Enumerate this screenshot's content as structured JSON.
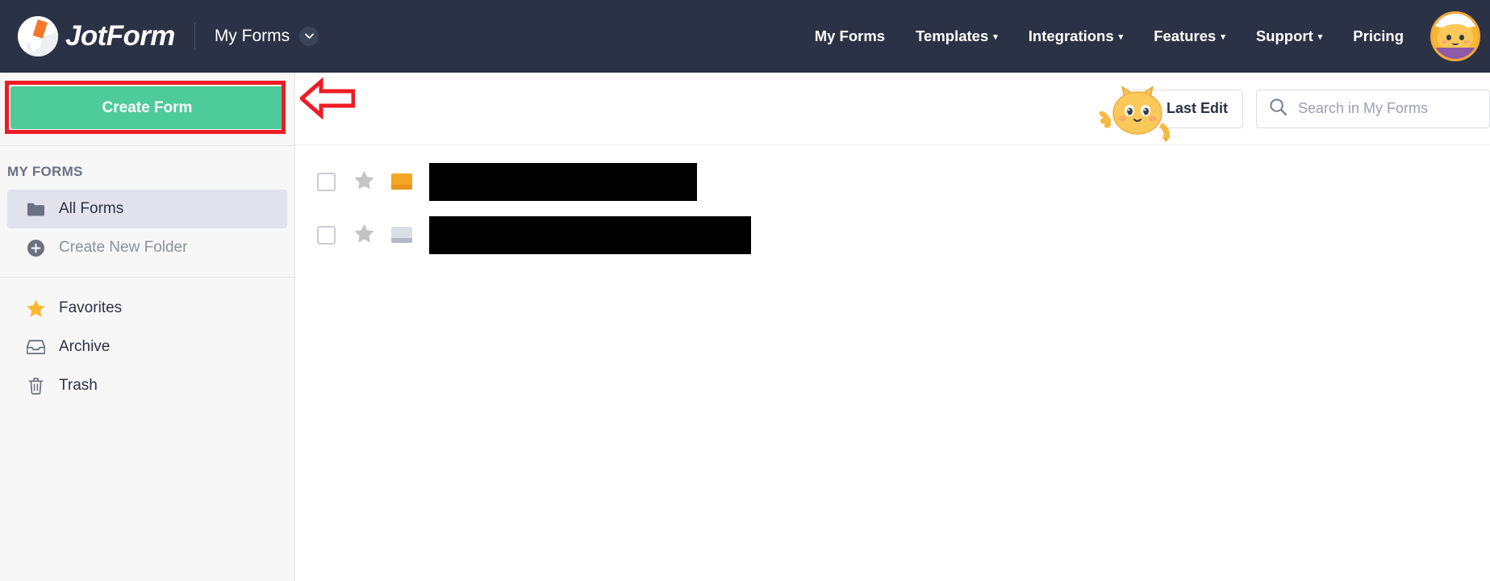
{
  "header": {
    "logo_text": "JotForm",
    "logo_icon": "jotform-pencil-logo",
    "workspace_switcher": "My Forms",
    "workspace_chevron_icon": "chevron-down-icon",
    "nav_items": [
      {
        "label": "My Forms",
        "has_dropdown": false
      },
      {
        "label": "Templates",
        "has_dropdown": true,
        "caret": "▾"
      },
      {
        "label": "Integrations",
        "has_dropdown": true,
        "caret": "▾"
      },
      {
        "label": "Features",
        "has_dropdown": true,
        "caret": "▾"
      },
      {
        "label": "Support",
        "has_dropdown": true,
        "caret": "▾"
      },
      {
        "label": "Pricing",
        "has_dropdown": false
      }
    ],
    "avatar_icon": "user-avatar-cat",
    "background_color": "#2b3245"
  },
  "sidebar": {
    "create_button": {
      "label": "Create Form",
      "color": "#4ecb9a",
      "highlight_color": "#ed1c24"
    },
    "section_label": "MY FORMS",
    "folders": [
      {
        "label": "All Forms",
        "icon": "folder-icon",
        "active": true
      },
      {
        "label": "Create New Folder",
        "icon": "plus-circle-icon",
        "active": false
      }
    ],
    "links": [
      {
        "label": "Favorites",
        "icon": "star-icon",
        "icon_color": "#ffb931"
      },
      {
        "label": "Archive",
        "icon": "archive-icon",
        "icon_color": "#6b7183"
      },
      {
        "label": "Trash",
        "icon": "trash-icon",
        "icon_color": "#6b7183"
      }
    ]
  },
  "toolbar": {
    "sort_button": {
      "label": "Last Edit",
      "icon": "sort-descending-icon"
    },
    "search": {
      "placeholder": "Search in My Forms",
      "value": "",
      "icon": "search-icon"
    },
    "mascot_icon": "waving-cat-mascot"
  },
  "form_list": {
    "rows": [
      {
        "checkbox_checked": false,
        "starred": false,
        "star_color": "#c4c4c4",
        "type_icon": "form-type-icon",
        "type_color": "#f5a623",
        "type_color_bottom": "#e8961a",
        "title_redacted": true,
        "redaction_width": 332
      },
      {
        "checkbox_checked": false,
        "starred": false,
        "star_color": "#c4c4c4",
        "type_icon": "form-type-icon",
        "type_color": "#dcdee6",
        "type_color_bottom": "#b4b8c6",
        "title_redacted": true,
        "redaction_width": 399
      }
    ]
  },
  "annotations": {
    "arrow": {
      "direction": "left",
      "color": "#ed1c24",
      "points_to": "create-form-button"
    }
  }
}
